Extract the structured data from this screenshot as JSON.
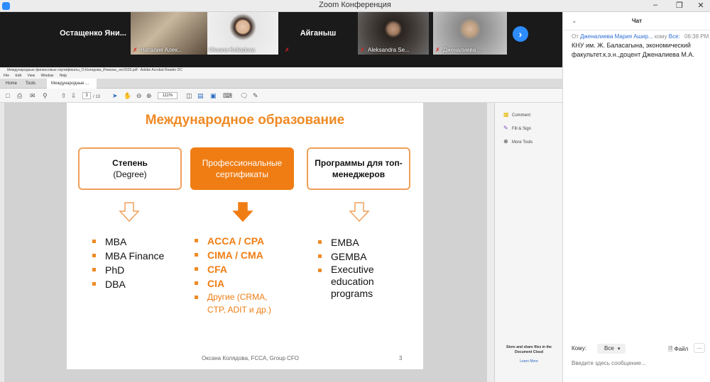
{
  "window": {
    "title": "Zoom Конференция"
  },
  "participants": [
    {
      "name": "Остащенко  Яни...",
      "type": "name"
    },
    {
      "name": "Наталия Алек...",
      "type": "cam",
      "muted": true
    },
    {
      "name": "Oksana Koliadova",
      "type": "cam",
      "muted": false
    },
    {
      "name": "Айганыш",
      "type": "name"
    },
    {
      "name": "Aleksandra Se...",
      "type": "cam",
      "muted": true
    },
    {
      "name": "Дженалиева ...",
      "type": "cam",
      "muted": true
    }
  ],
  "acrobat": {
    "title": "Международные финансовые сертификаты_О.Колядова_Ичкизни_окт2020.pdf - Adobe Acrobat Reader DC",
    "menu": [
      "File",
      "Edit",
      "View",
      "Window",
      "Help"
    ],
    "tabs": [
      "Home",
      "Tools",
      "Международные ..."
    ],
    "page_current": "3",
    "page_total": "/ 13",
    "zoom": "111%",
    "right_tools": [
      "Comment",
      "Fill & Sign",
      "More Tools"
    ],
    "cloud_text": "Store and share files in the Document Cloud",
    "cloud_link": "Learn More"
  },
  "slide": {
    "title": "Международное образование",
    "boxes": [
      {
        "line1": "Степень",
        "line2": "(Degree)"
      },
      {
        "line1": "Профессиональные",
        "line2": "сертификаты"
      },
      {
        "line1": "Программы для топ-",
        "line2": "менеджеров"
      }
    ],
    "col1": [
      "MBA",
      "MBA Finance",
      "PhD",
      "DBA"
    ],
    "col2": [
      "ACCA / CPA",
      "CIMA / CMA",
      "CFA",
      "CIA"
    ],
    "col2_other_l1": "Другие (CRMA,",
    "col2_other_l2": "CTP, ADIT и др.)",
    "col3": [
      "EMBA",
      "GEMBA"
    ],
    "col3_last_l1": "Executive",
    "col3_last_l2": "education",
    "col3_last_l3": "programs",
    "footer": "Оксана Колядова, FCCA, Group CFO",
    "page_number": "3"
  },
  "chat": {
    "title": "Чат",
    "msg_from_label": "От",
    "msg_from": "Дженалиева Мария Ашир...",
    "msg_to_label": "кому",
    "msg_to": "Все:",
    "msg_time": "06:38 PM",
    "msg_text": "КНУ им. Ж. Баласагына, экономический факультет.к.э.н.,доцент Дженалиева М.А.",
    "to_label": "Кому:",
    "to_value": "Все",
    "file_label": "Файл",
    "more_label": "...",
    "input_placeholder": "Введите здесь сообщение..."
  },
  "colors": {
    "accent": "#ef7d14",
    "zoom_blue": "#2d8cff"
  }
}
